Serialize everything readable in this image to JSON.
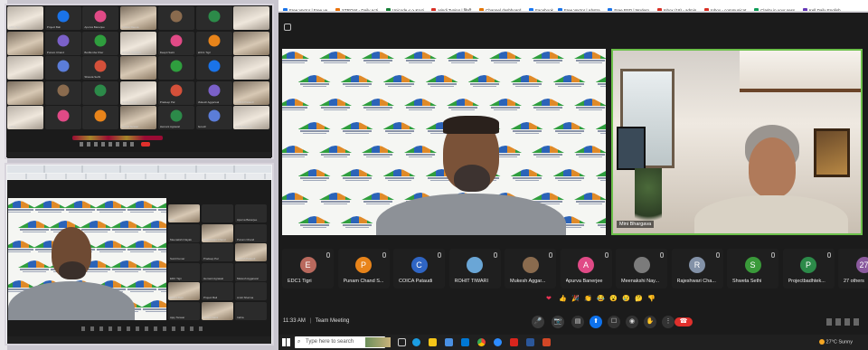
{
  "bookmarks": [
    "Free Vector | Free ve...",
    "STROmt - Daily Acti...",
    "Unicode <-> Kruti...",
    "Hindi Typing | हिन्दी...",
    "Channel dashboard...",
    "Facebook",
    "Free Vector | Abstra...",
    "Free PSD | Modern...",
    "Inbox (18) - admin...",
    "Inbox - communicat...",
    "Clarity in your sess...",
    "Kell Daily English"
  ],
  "small_grid_names": [
    "EDC Tigri",
    "Project Bali",
    "Apurva Banerjee",
    "Malavi Reena",
    "",
    "",
    "",
    "",
    "Punam Chand",
    "Bodfumba Kher",
    "ROHIT TIWARI",
    "Deepti Saini",
    "EDC1 Tigri",
    "",
    "",
    "",
    "Shweta Sethi",
    "",
    "",
    "",
    "",
    "",
    "",
    "",
    "Sunil Kumar",
    "Pradeep Pal",
    "Mukesh Aggarwal",
    "COICA Pataudi",
    "Indira",
    "",
    "",
    "Ranjit Tanwar",
    "Hemant Agrawal",
    "Suresh",
    "Amitt Sharma",
    "Ajaygreen Tanwar",
    "Projectbadhtekh"
  ],
  "second_window": {
    "title": "Zoom Meeting",
    "side_names": [
      "Kirti",
      "",
      "Apurva Banerjee",
      "Meenakshi Nayak",
      "Rajeshwari Chand",
      "Punam Chand",
      "Sunil Kumar",
      "Pradeep Pal",
      "COICA Pataudi",
      "EDC Tigri",
      "Hemant Agrawal",
      "Mukesh Aggarwal",
      "EDC1 Tigri",
      "Project Bali",
      "Amitt Sharma",
      "Ajay Tanwar",
      "Deepti Saini",
      "Indira"
    ]
  },
  "video": {
    "presenter_name": "",
    "participant_name": "Mini Bhargava"
  },
  "participants": [
    {
      "initial": "E",
      "name": "EDC1 Tigri",
      "color": "#b9695d"
    },
    {
      "initial": "P",
      "name": "Punam Chand S...",
      "color": "#e8841a"
    },
    {
      "initial": "C",
      "name": "COICA Pataudi",
      "color": "#2f65c4"
    },
    {
      "initial": "",
      "name": "ROHIT TIWARI",
      "color": "#6aa6d6"
    },
    {
      "initial": "",
      "name": "Mukesh Aggar...",
      "color": "#8a6b4e"
    },
    {
      "initial": "A",
      "name": "Apurva Banerjee",
      "color": "#e04a86"
    },
    {
      "initial": "",
      "name": "Meenakshi Nay...",
      "color": "#7b7b7b"
    },
    {
      "initial": "R",
      "name": "Rajeshwari Cha...",
      "color": "#8392a8"
    },
    {
      "initial": "S",
      "name": "Shweta Sethi",
      "color": "#3a9a3a"
    },
    {
      "initial": "P",
      "name": "Projectbadhtek...",
      "color": "#2c8a49"
    },
    {
      "initial": "27",
      "name": "27 others",
      "color": "#8b5a9e"
    }
  ],
  "meeting": {
    "time": "11:33 AM",
    "separator": "|",
    "title": "Team Meeting"
  },
  "reactions": [
    "heart-icon",
    "thumbs-up-icon",
    "party-icon",
    "clap-icon",
    "laugh-icon",
    "surprised-icon",
    "sad-icon",
    "thinking-icon",
    "thumbs-down-icon"
  ],
  "taskbar": {
    "search_placeholder": "Type here to search",
    "weather": "27°C  Sunny"
  },
  "colors": {
    "leave": "#e0302c",
    "meet_bg": "#1b1b1b",
    "accent": "#0e72ed"
  }
}
